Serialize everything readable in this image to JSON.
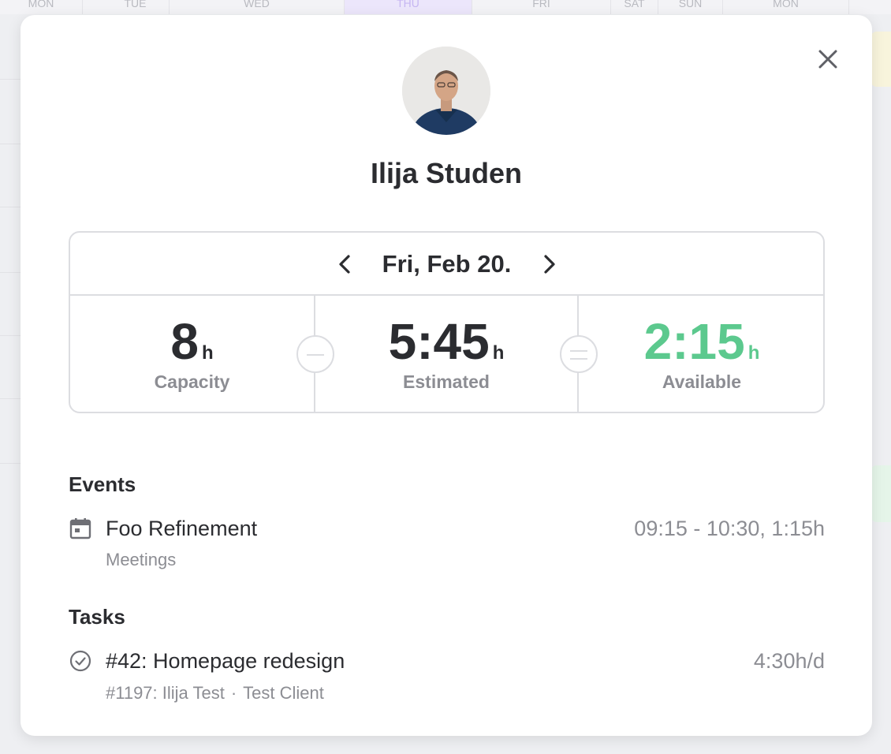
{
  "background": {
    "days": [
      "MON",
      "TUE",
      "WED",
      "THU",
      "FRI",
      "SAT",
      "SUN",
      "MON"
    ]
  },
  "user": {
    "name": "Ilija Studen"
  },
  "summary": {
    "date": "Fri, Feb 20.",
    "capacity": {
      "value": "8",
      "unit": "h",
      "label": "Capacity"
    },
    "estimated": {
      "value": "5:45",
      "unit": "h",
      "label": "Estimated"
    },
    "available": {
      "value": "2:15",
      "unit": "h",
      "label": "Available",
      "color": "#5cc98e"
    }
  },
  "events": {
    "title": "Events",
    "items": [
      {
        "icon": "calendar-icon",
        "title": "Foo Refinement",
        "subtitle": "Meetings",
        "time": "09:15 - 10:30, 1:15h"
      }
    ]
  },
  "tasks": {
    "title": "Tasks",
    "items": [
      {
        "icon": "check-circle-icon",
        "title": "#42: Homepage redesign",
        "project": "#1197: Ilija Test",
        "separator": "·",
        "client": "Test Client",
        "time": "4:30h/d"
      }
    ]
  }
}
